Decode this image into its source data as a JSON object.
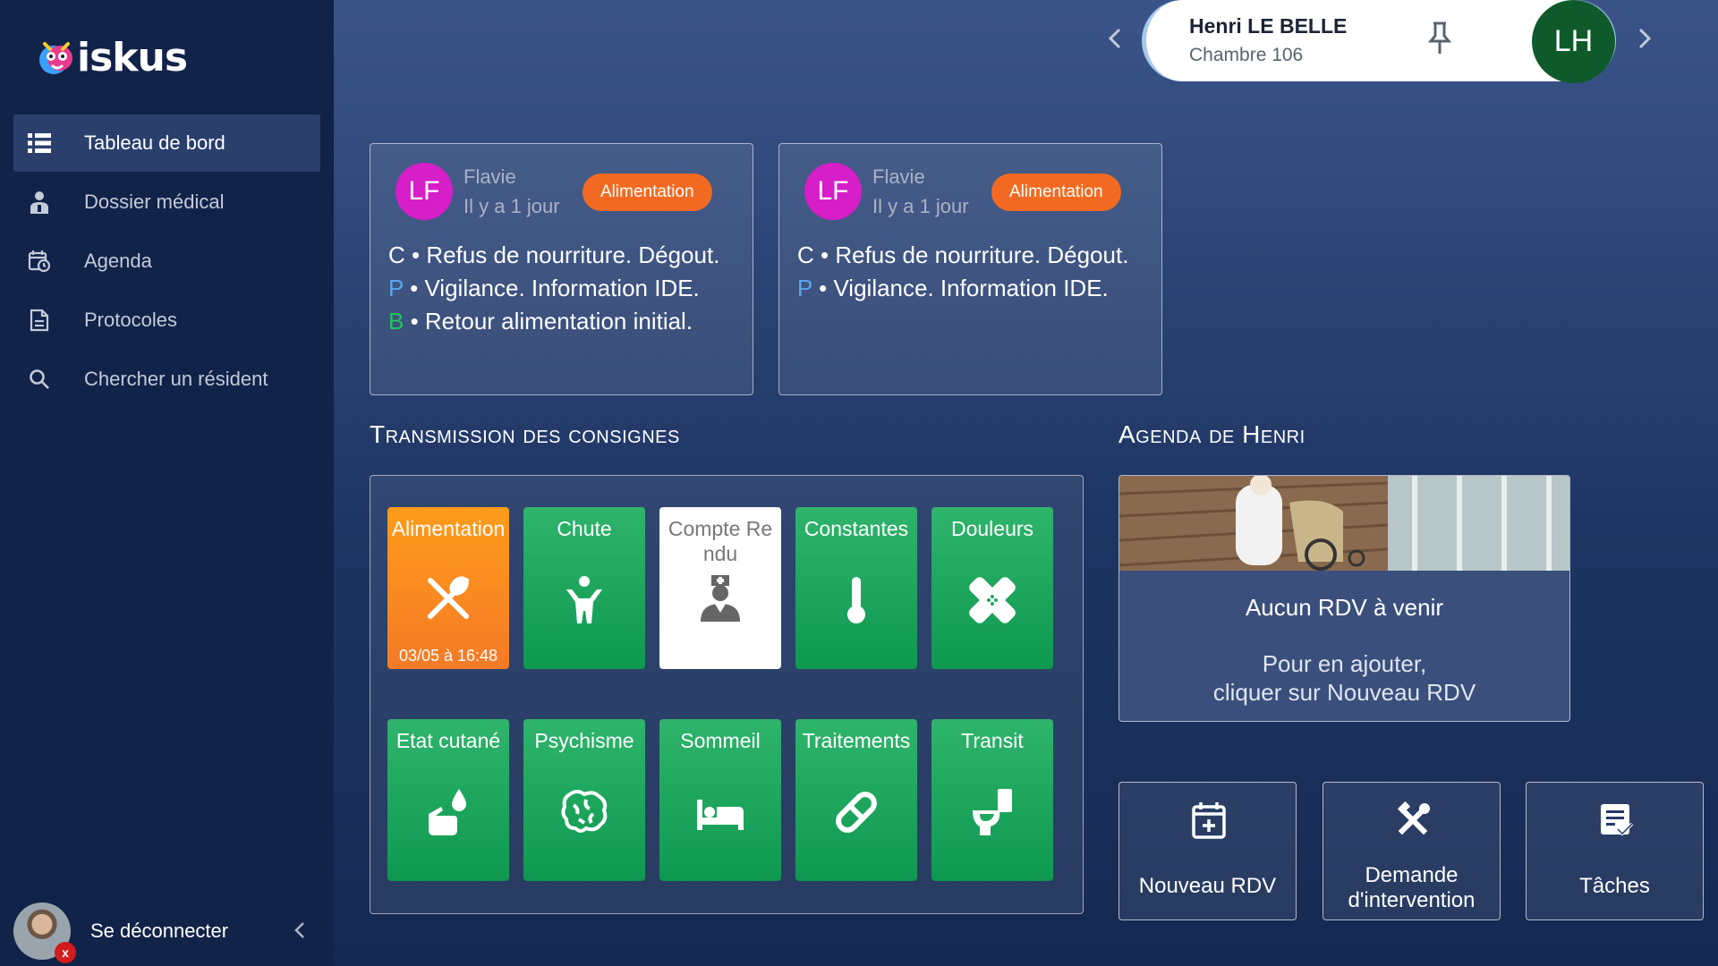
{
  "app": {
    "logo_text": "iskus"
  },
  "sidebar": {
    "items": [
      {
        "label": "Tableau de bord",
        "icon": "list-icon",
        "active": true
      },
      {
        "label": "Dossier médical",
        "icon": "patient-icon",
        "active": false
      },
      {
        "label": "Agenda",
        "icon": "calendar-clock-icon",
        "active": false
      },
      {
        "label": "Protocoles",
        "icon": "document-icon",
        "active": false
      },
      {
        "label": "Chercher un résident",
        "icon": "search-icon",
        "active": false
      }
    ],
    "logout_label": "Se déconnecter",
    "avatar_badge": "x"
  },
  "resident": {
    "name": "Henri LE BELLE",
    "room": "Chambre 106",
    "initials": "LH",
    "avatar_color": "#0f5a2a"
  },
  "notes": [
    {
      "initials": "LF",
      "author": "Flavie",
      "time": "Il y a 1 jour",
      "tag": "Alimentation",
      "lines": [
        {
          "letter": "C",
          "text": "Refus de nourriture. Dégout."
        },
        {
          "letter": "P",
          "text": "Vigilance. Information IDE."
        },
        {
          "letter": "B",
          "text": "Retour alimentation initial."
        }
      ]
    },
    {
      "initials": "LF",
      "author": "Flavie",
      "time": "Il y a 1 jour",
      "tag": "Alimentation",
      "lines": [
        {
          "letter": "C",
          "text": "Refus de nourriture. Dégout."
        },
        {
          "letter": "P",
          "text": "Vigilance. Information IDE."
        }
      ]
    }
  ],
  "consignes": {
    "title": "Transmission des consignes",
    "tiles": [
      {
        "label": "Alimentation",
        "icon": "utensils-icon",
        "date": "03/05 à 16:48",
        "style": "orange"
      },
      {
        "label": "Chute",
        "icon": "person-icon",
        "style": "green"
      },
      {
        "label": "Compte Rendu",
        "icon": "nurse-icon",
        "style": "white"
      },
      {
        "label": "Constantes",
        "icon": "thermometer-icon",
        "style": "green"
      },
      {
        "label": "Douleurs",
        "icon": "bandage-icon",
        "style": "green"
      },
      {
        "label": "Etat cutané",
        "icon": "hand-drop-icon",
        "style": "green"
      },
      {
        "label": "Psychisme",
        "icon": "brain-icon",
        "style": "green"
      },
      {
        "label": "Sommeil",
        "icon": "bed-icon",
        "style": "green"
      },
      {
        "label": "Traitements",
        "icon": "pill-icon",
        "style": "green"
      },
      {
        "label": "Transit",
        "icon": "toilet-icon",
        "style": "green"
      }
    ]
  },
  "agenda": {
    "title": "Agenda de Henri",
    "empty": "Aucun RDV à venir",
    "hint_line1": "Pour en ajouter,",
    "hint_line2": "cliquer sur Nouveau RDV"
  },
  "actions": [
    {
      "label_line1": "Nouveau RDV",
      "label_line2": "",
      "icon": "calendar-plus-icon"
    },
    {
      "label_line1": "Demande",
      "label_line2": "d'intervention",
      "icon": "tools-icon"
    },
    {
      "label_line1": "Tâches",
      "label_line2": "",
      "icon": "task-list-icon"
    }
  ],
  "colors": {
    "sidebar_bg": "#122349",
    "tag_orange": "#f26a21",
    "tile_green": "#1fa85f",
    "tile_orange": "#f58a22",
    "note_avatar": "#d61ec9",
    "letter_p": "#5aa6f0",
    "letter_b": "#22c45e"
  }
}
